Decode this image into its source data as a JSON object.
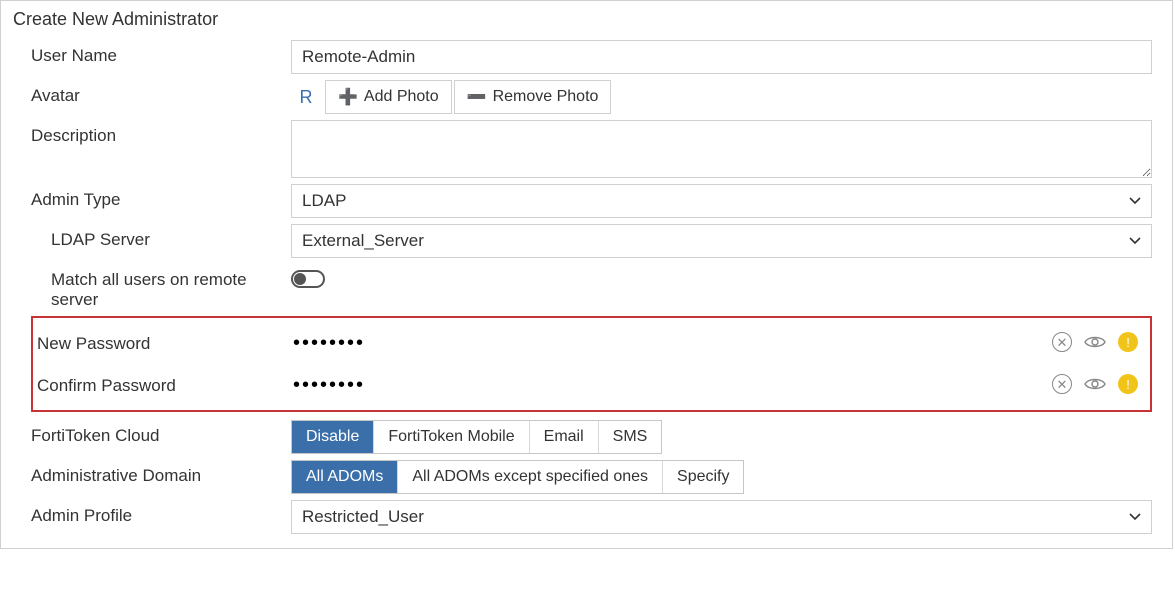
{
  "panel": {
    "title": "Create New Administrator"
  },
  "labels": {
    "user_name": "User Name",
    "avatar": "Avatar",
    "description": "Description",
    "admin_type": "Admin Type",
    "ldap_server": "LDAP Server",
    "match_all": "Match all users on remote server",
    "new_password": "New Password",
    "confirm_password": "Confirm Password",
    "fortitoken": "FortiToken Cloud",
    "adom": "Administrative Domain",
    "admin_profile": "Admin Profile"
  },
  "values": {
    "user_name": "Remote-Admin",
    "avatar_initial": "R",
    "description": "",
    "admin_type": "LDAP",
    "ldap_server": "External_Server",
    "match_all": false,
    "new_password": "••••••••",
    "confirm_password": "••••••••",
    "admin_profile": "Restricted_User"
  },
  "buttons": {
    "add_photo": "Add Photo",
    "remove_photo": "Remove Photo"
  },
  "fortitoken_options": [
    "Disable",
    "FortiToken Mobile",
    "Email",
    "SMS"
  ],
  "fortitoken_selected": "Disable",
  "adom_options": [
    "All ADOMs",
    "All ADOMs except specified ones",
    "Specify"
  ],
  "adom_selected": "All ADOMs",
  "colors": {
    "accent": "#3b6fa9",
    "highlight": "#c73434",
    "warn": "#f0c419"
  }
}
